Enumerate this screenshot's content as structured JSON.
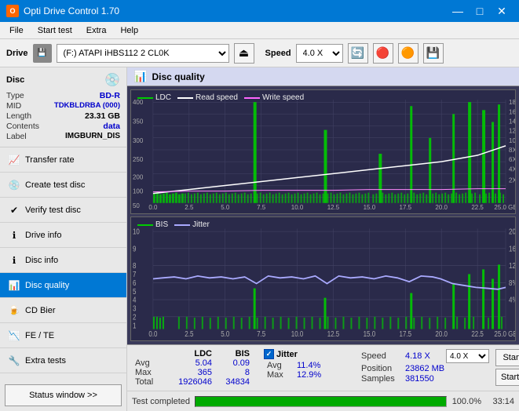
{
  "titleBar": {
    "title": "Opti Drive Control 1.70",
    "minimize": "—",
    "maximize": "□",
    "close": "✕"
  },
  "menuBar": {
    "items": [
      "File",
      "Start test",
      "Extra",
      "Help"
    ]
  },
  "driveBar": {
    "label": "Drive",
    "driveValue": "(F:)  ATAPI iHBS112  2 CL0K",
    "speedLabel": "Speed",
    "speedValue": "4.0 X"
  },
  "sidebar": {
    "discTitle": "Disc",
    "discRows": [
      {
        "label": "Type",
        "value": "BD-R"
      },
      {
        "label": "MID",
        "value": "TDKBLDRBA (000)"
      },
      {
        "label": "Length",
        "value": "23.31 GB"
      },
      {
        "label": "Contents",
        "value": "data"
      },
      {
        "label": "Label",
        "value": "IMGBURN_DIS"
      }
    ],
    "navItems": [
      {
        "id": "transfer-rate",
        "label": "Transfer rate",
        "icon": "📈"
      },
      {
        "id": "create-test-disc",
        "label": "Create test disc",
        "icon": "💿"
      },
      {
        "id": "verify-test-disc",
        "label": "Verify test disc",
        "icon": "✔"
      },
      {
        "id": "drive-info",
        "label": "Drive info",
        "icon": "ℹ"
      },
      {
        "id": "disc-info",
        "label": "Disc info",
        "icon": "ℹ"
      },
      {
        "id": "disc-quality",
        "label": "Disc quality",
        "icon": "📊",
        "active": true
      },
      {
        "id": "cd-bier",
        "label": "CD Bier",
        "icon": "🍺"
      },
      {
        "id": "fe-te",
        "label": "FE / TE",
        "icon": "📉"
      },
      {
        "id": "extra-tests",
        "label": "Extra tests",
        "icon": "🔧"
      }
    ],
    "statusBtn": "Status window >>"
  },
  "discQuality": {
    "title": "Disc quality",
    "legend": {
      "ldc": "LDC",
      "readSpeed": "Read speed",
      "writeSpeed": "Write speed",
      "bis": "BIS",
      "jitter": "Jitter"
    }
  },
  "stats": {
    "columns": [
      "LDC",
      "BIS"
    ],
    "rows": [
      {
        "label": "Avg",
        "ldc": "5.04",
        "bis": "0.09"
      },
      {
        "label": "Max",
        "ldc": "365",
        "bis": "8"
      },
      {
        "label": "Total",
        "ldc": "1926046",
        "bis": "34834"
      }
    ],
    "jitterLabel": "Jitter",
    "jitterRows": [
      {
        "label": "Avg",
        "val": "11.4%"
      },
      {
        "label": "Max",
        "val": "12.9%"
      }
    ],
    "speedLabel": "Speed",
    "speedValue": "4.18 X",
    "speedSelect": "4.0 X",
    "positionLabel": "Position",
    "positionValue": "23862 MB",
    "samplesLabel": "Samples",
    "samplesValue": "381550",
    "startFull": "Start full",
    "startPart": "Start part"
  },
  "progress": {
    "label": "Test completed",
    "percent": 100,
    "percentText": "100.0%",
    "time": "33:14"
  }
}
